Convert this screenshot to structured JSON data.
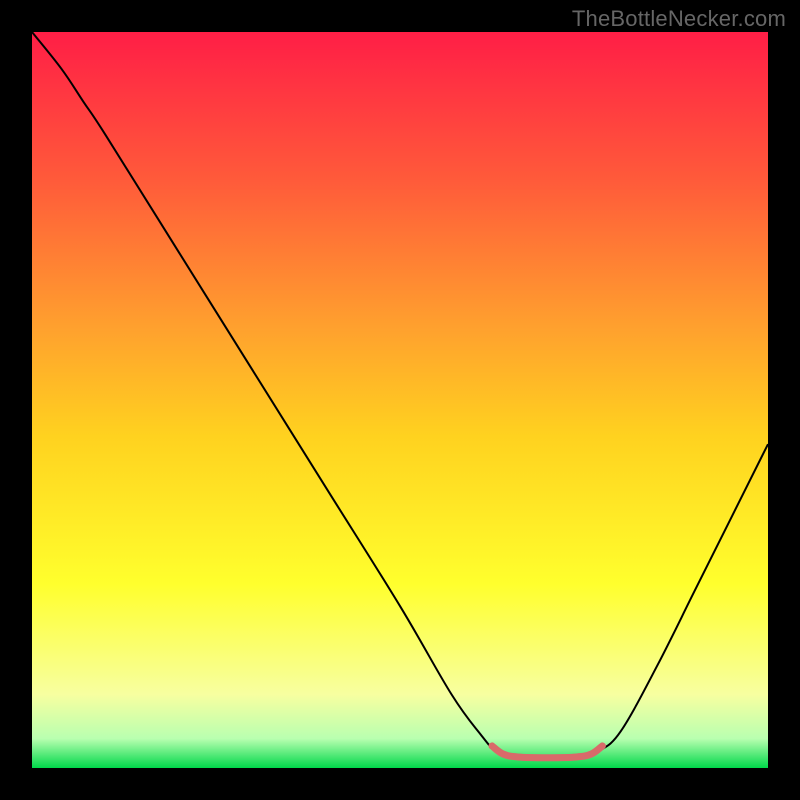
{
  "watermark": "TheBottleNecker.com",
  "chart_data": {
    "type": "line",
    "title": "",
    "xlabel": "",
    "ylabel": "",
    "xlim": [
      0,
      100
    ],
    "ylim": [
      0,
      100
    ],
    "gradient_stops": [
      {
        "offset": 0,
        "color": "#ff1e46"
      },
      {
        "offset": 20,
        "color": "#ff5a3a"
      },
      {
        "offset": 40,
        "color": "#ffa02e"
      },
      {
        "offset": 55,
        "color": "#ffd21f"
      },
      {
        "offset": 75,
        "color": "#ffff2d"
      },
      {
        "offset": 90,
        "color": "#f7ffa0"
      },
      {
        "offset": 96,
        "color": "#b9ffb0"
      },
      {
        "offset": 100,
        "color": "#00d84a"
      }
    ],
    "series": [
      {
        "name": "bottleneck-curve",
        "stroke": "#000000",
        "stroke_width": 2,
        "points": [
          {
            "x": 0,
            "y": 100
          },
          {
            "x": 4,
            "y": 95
          },
          {
            "x": 7,
            "y": 90.5
          },
          {
            "x": 10,
            "y": 86
          },
          {
            "x": 20,
            "y": 70
          },
          {
            "x": 30,
            "y": 54
          },
          {
            "x": 40,
            "y": 38
          },
          {
            "x": 50,
            "y": 22
          },
          {
            "x": 57,
            "y": 10
          },
          {
            "x": 61,
            "y": 4.5
          },
          {
            "x": 63,
            "y": 2.3
          },
          {
            "x": 65,
            "y": 1.6
          },
          {
            "x": 68,
            "y": 1.4
          },
          {
            "x": 72,
            "y": 1.4
          },
          {
            "x": 75,
            "y": 1.6
          },
          {
            "x": 77,
            "y": 2.3
          },
          {
            "x": 80,
            "y": 5
          },
          {
            "x": 85,
            "y": 14
          },
          {
            "x": 90,
            "y": 24
          },
          {
            "x": 95,
            "y": 34
          },
          {
            "x": 100,
            "y": 44
          }
        ]
      }
    ],
    "highlight": {
      "name": "valley-highlight",
      "stroke": "#d96a6a",
      "stroke_width": 7,
      "points": [
        {
          "x": 62.5,
          "y": 3.0
        },
        {
          "x": 64,
          "y": 1.9
        },
        {
          "x": 66,
          "y": 1.5
        },
        {
          "x": 70,
          "y": 1.4
        },
        {
          "x": 74,
          "y": 1.5
        },
        {
          "x": 76,
          "y": 1.9
        },
        {
          "x": 77.5,
          "y": 3.0
        }
      ]
    }
  }
}
